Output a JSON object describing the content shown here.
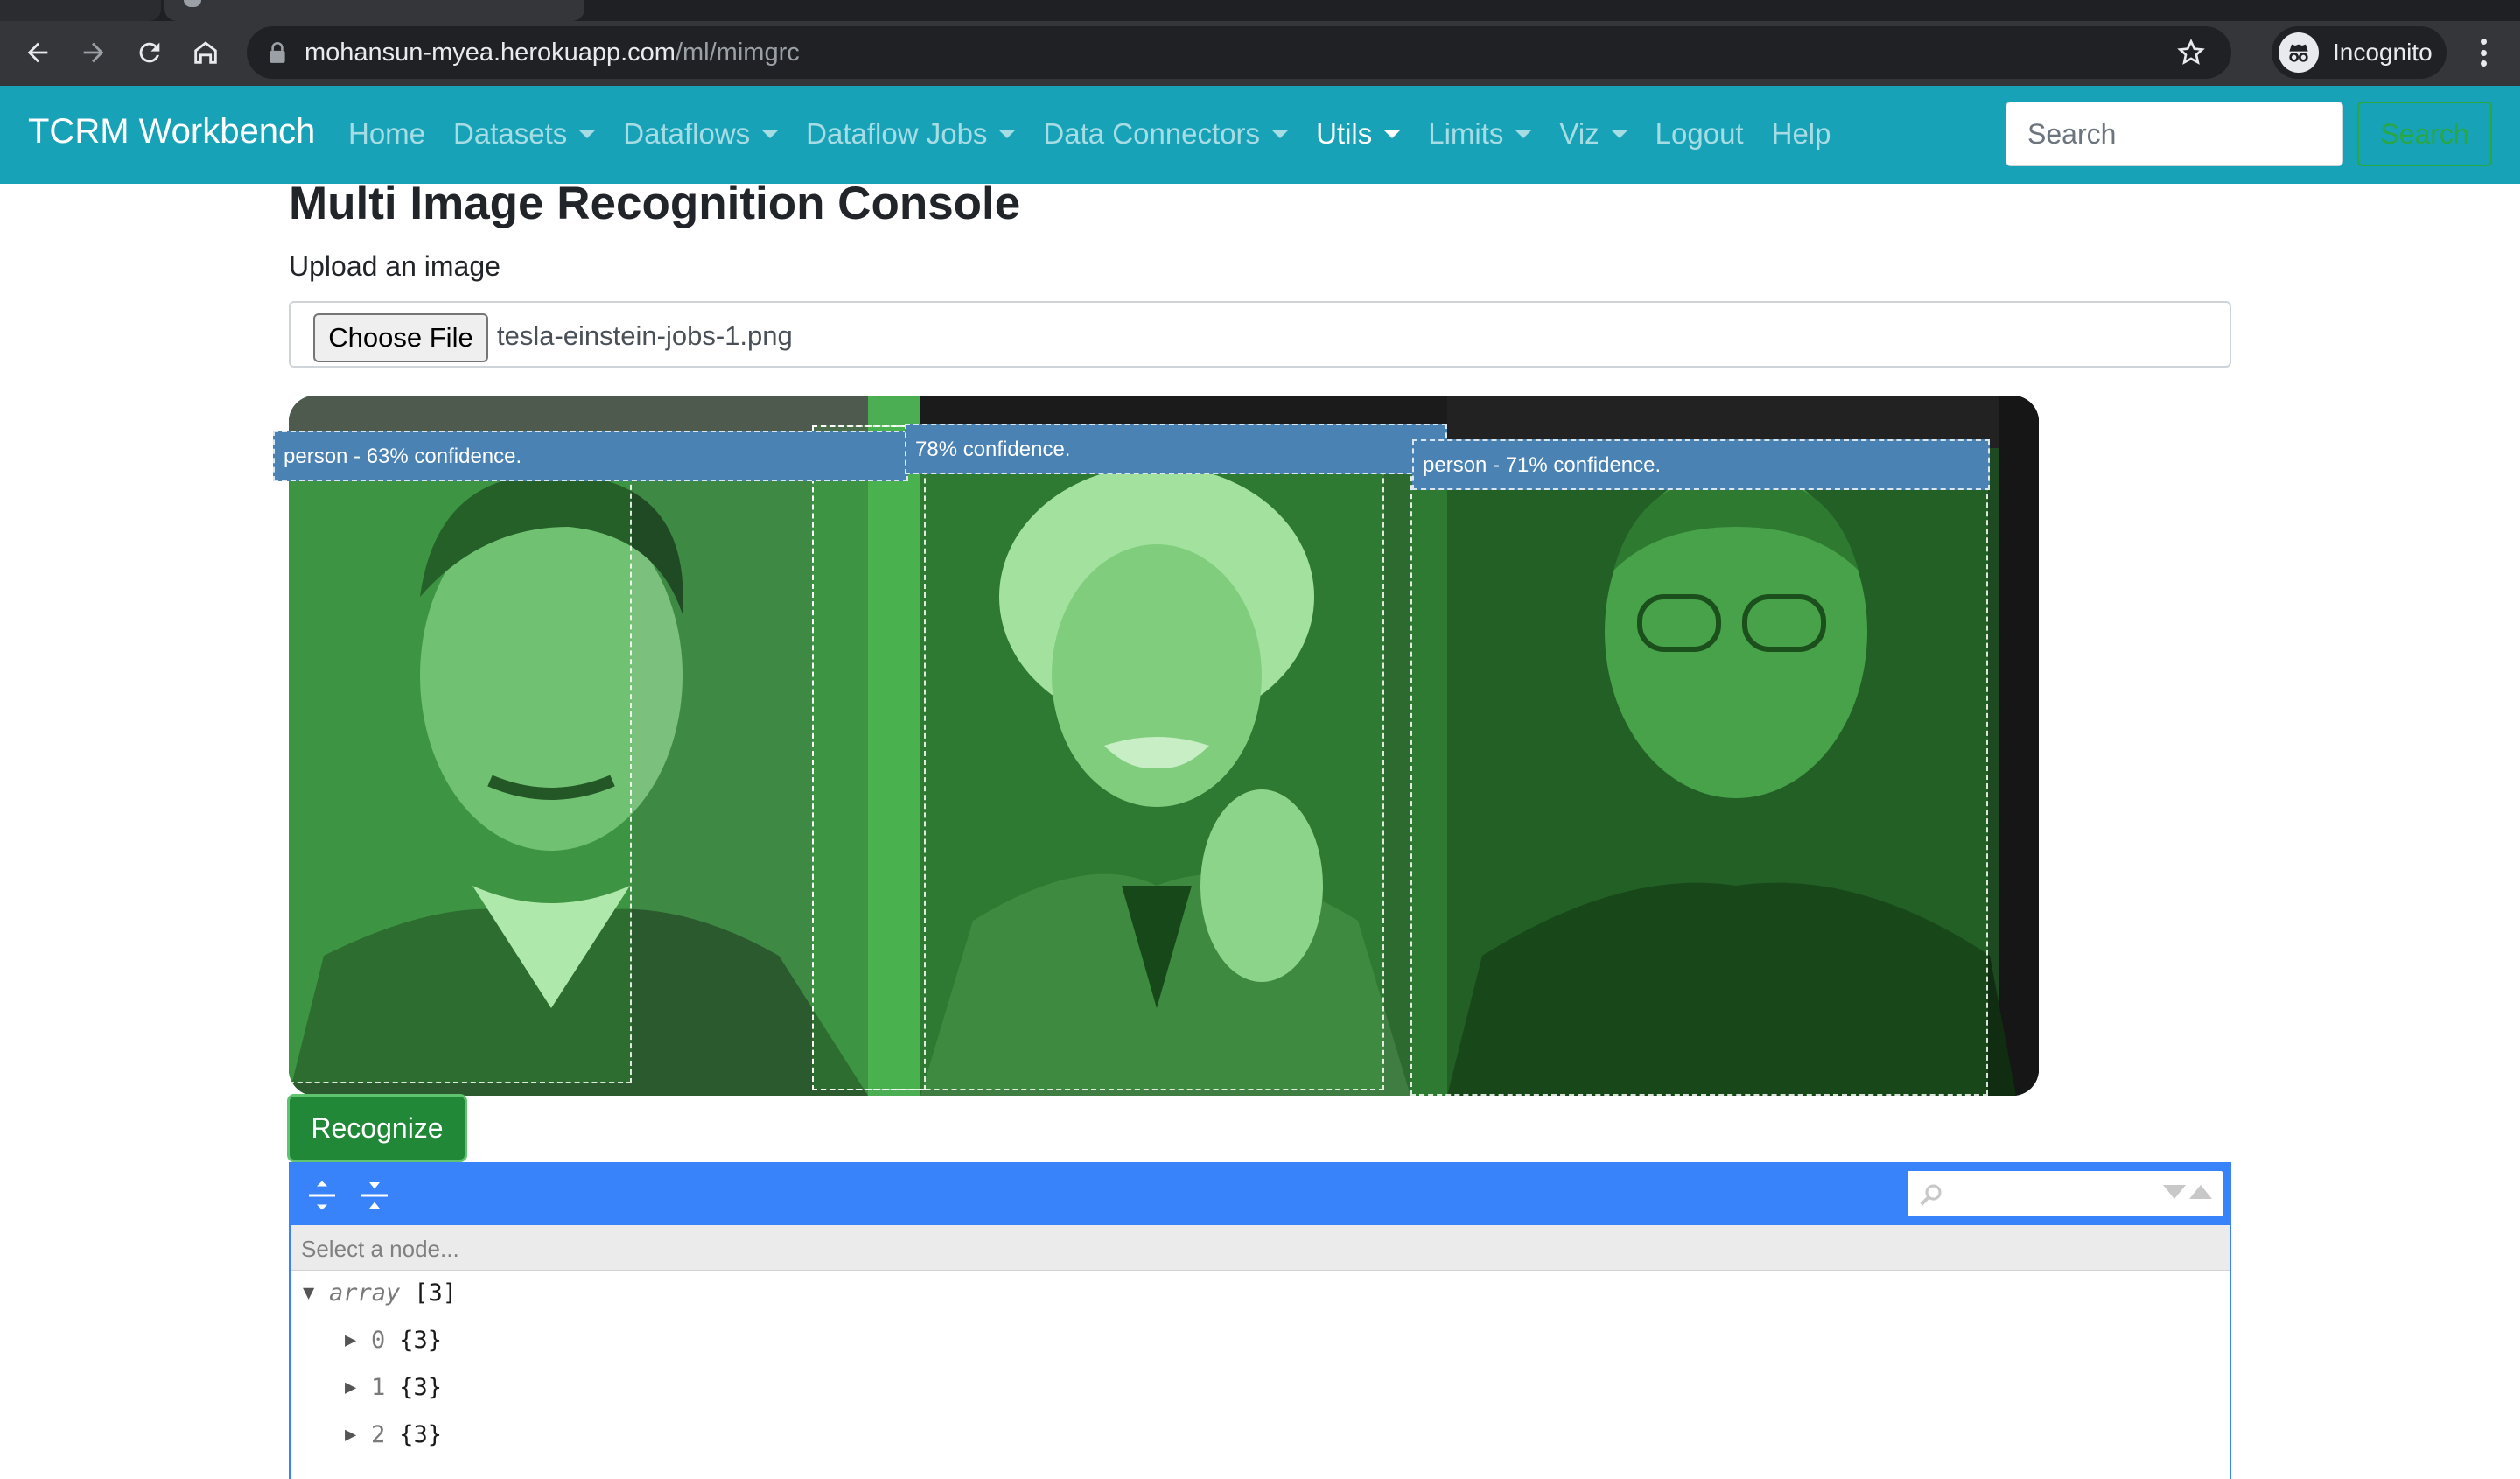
{
  "browser": {
    "url_host": "mohansun-myea.herokuapp.com",
    "url_path": "/ml/mimgrc",
    "profile_label": "Incognito"
  },
  "navbar": {
    "brand": "TCRM Workbench",
    "items": [
      {
        "label": "Home",
        "dropdown": false,
        "active": false
      },
      {
        "label": "Datasets",
        "dropdown": true,
        "active": false
      },
      {
        "label": "Dataflows",
        "dropdown": true,
        "active": false
      },
      {
        "label": "Dataflow Jobs",
        "dropdown": true,
        "active": false
      },
      {
        "label": "Data Connectors",
        "dropdown": true,
        "active": false
      },
      {
        "label": "Utils",
        "dropdown": true,
        "active": true
      },
      {
        "label": "Limits",
        "dropdown": true,
        "active": false
      },
      {
        "label": "Viz",
        "dropdown": true,
        "active": false
      },
      {
        "label": "Logout",
        "dropdown": false,
        "active": false
      },
      {
        "label": "Help",
        "dropdown": false,
        "active": false
      }
    ],
    "search_placeholder": "Search",
    "search_button": "Search"
  },
  "page": {
    "title": "Multi Image Recognition Console",
    "upload_label": "Upload an image",
    "choose_file_label": "Choose File",
    "file_name": "tesla-einstein-jobs-1.png",
    "recognize_label": "Recognize"
  },
  "detections": [
    {
      "label": "person - 63% confidence."
    },
    {
      "label": "78% confidence."
    },
    {
      "label": "person - 71% confidence."
    }
  ],
  "json_viewer": {
    "nav_placeholder": "Select a node...",
    "root": {
      "key": "array",
      "count": "[3]"
    },
    "children": [
      {
        "key": "0",
        "count": "{3}"
      },
      {
        "key": "1",
        "count": "{3}"
      },
      {
        "key": "2",
        "count": "{3}"
      }
    ]
  },
  "colors": {
    "navbar": "#17a2b8",
    "json_accent": "#3883fa",
    "success": "#28a745",
    "label_bg": "#4a82b4"
  }
}
